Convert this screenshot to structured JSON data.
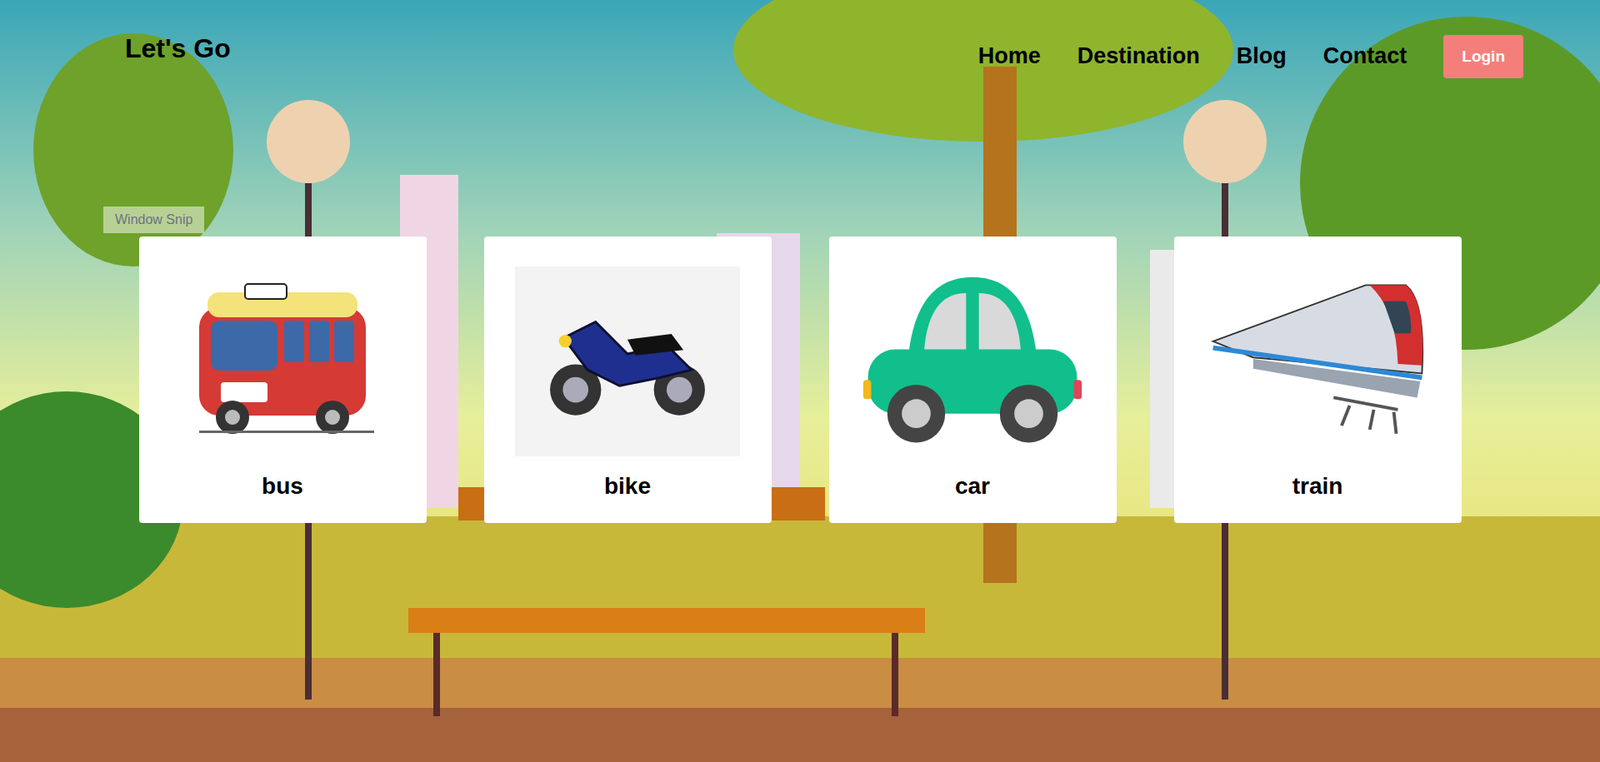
{
  "brand": "Let's Go",
  "nav": [
    {
      "label": "Home"
    },
    {
      "label": "Destination"
    },
    {
      "label": "Blog"
    },
    {
      "label": "Contact"
    }
  ],
  "login": "Login",
  "overlay": "Window Snip",
  "cards": [
    {
      "label": "bus"
    },
    {
      "label": "bike"
    },
    {
      "label": "car"
    },
    {
      "label": "train"
    }
  ]
}
